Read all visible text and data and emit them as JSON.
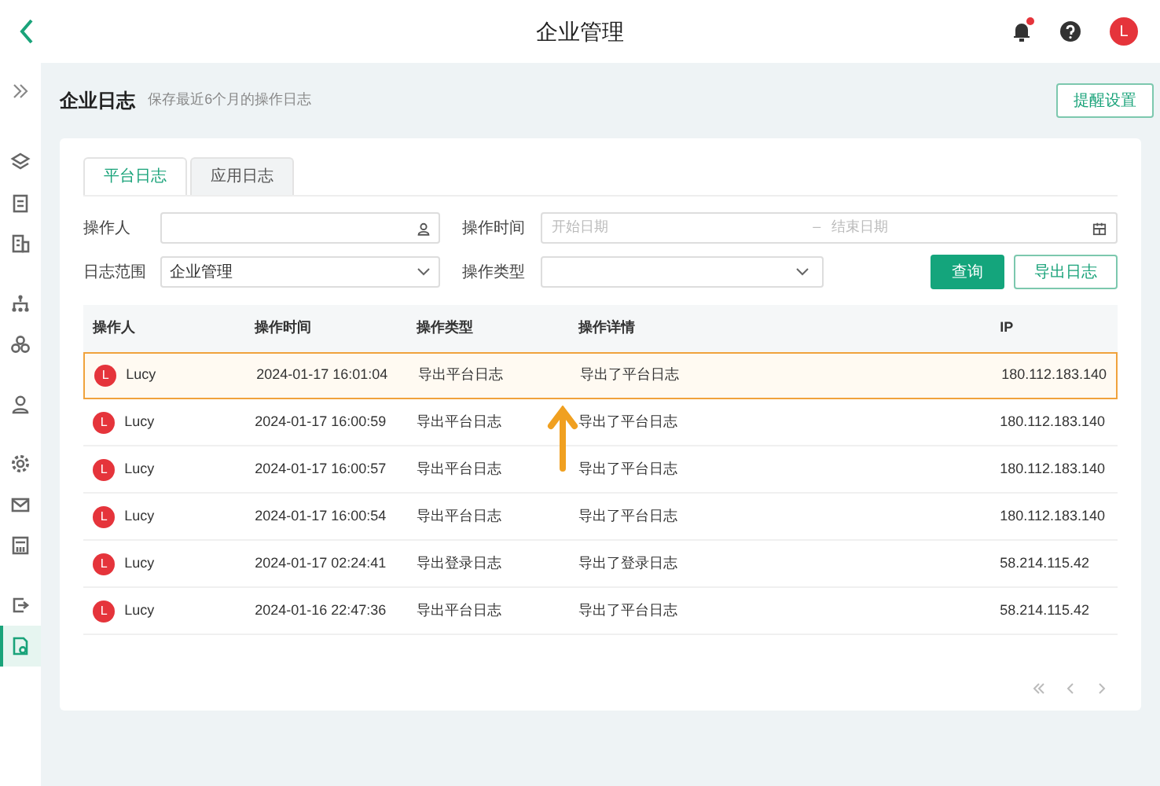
{
  "header": {
    "title": "企业管理",
    "avatar": "L",
    "notification_dot": true
  },
  "sidebar": {
    "items": [
      {
        "selected": false
      },
      {
        "selected": false
      },
      {
        "selected": false
      },
      {
        "selected": false
      },
      {
        "selected": false
      },
      {
        "selected": false
      },
      {
        "selected": false
      },
      {
        "selected": false
      },
      {
        "selected": false
      },
      {
        "selected": false
      },
      {
        "selected": true
      }
    ]
  },
  "page": {
    "title": "企业日志",
    "subtitle": "保存最近6个月的操作日志",
    "action": "提醒设置"
  },
  "tabs": [
    {
      "label": "平台日志",
      "selected": true
    },
    {
      "label": "应用日志",
      "selected": false
    }
  ],
  "filters": {
    "operator_label": "操作人",
    "time_label": "操作时间",
    "start_placeholder": "开始日期",
    "range_separator": "–",
    "end_placeholder": "结束日期",
    "scope_label": "日志范围",
    "scope_value": "企业管理",
    "type_label": "操作类型",
    "query_button": "查询",
    "export_button": "导出日志"
  },
  "table": {
    "columns": [
      "操作人",
      "操作时间",
      "操作类型",
      "操作详情",
      "IP"
    ],
    "rows": [
      {
        "avatar": "L",
        "operator": "Lucy",
        "time": "2024-01-17 16:01:04",
        "type": "导出平台日志",
        "detail": "导出了平台日志",
        "ip": "180.112.183.140",
        "selected": true
      },
      {
        "avatar": "L",
        "operator": "Lucy",
        "time": "2024-01-17 16:00:59",
        "type": "导出平台日志",
        "detail": "导出了平台日志",
        "ip": "180.112.183.140",
        "selected": false
      },
      {
        "avatar": "L",
        "operator": "Lucy",
        "time": "2024-01-17 16:00:57",
        "type": "导出平台日志",
        "detail": "导出了平台日志",
        "ip": "180.112.183.140",
        "selected": false
      },
      {
        "avatar": "L",
        "operator": "Lucy",
        "time": "2024-01-17 16:00:54",
        "type": "导出平台日志",
        "detail": "导出了平台日志",
        "ip": "180.112.183.140",
        "selected": false
      },
      {
        "avatar": "L",
        "operator": "Lucy",
        "time": "2024-01-17 02:24:41",
        "type": "导出登录日志",
        "detail": "导出了登录日志",
        "ip": "58.214.115.42",
        "selected": false
      },
      {
        "avatar": "L",
        "operator": "Lucy",
        "time": "2024-01-16 22:47:36",
        "type": "导出平台日志",
        "detail": "导出了平台日志",
        "ip": "58.214.115.42",
        "selected": false
      }
    ]
  }
}
